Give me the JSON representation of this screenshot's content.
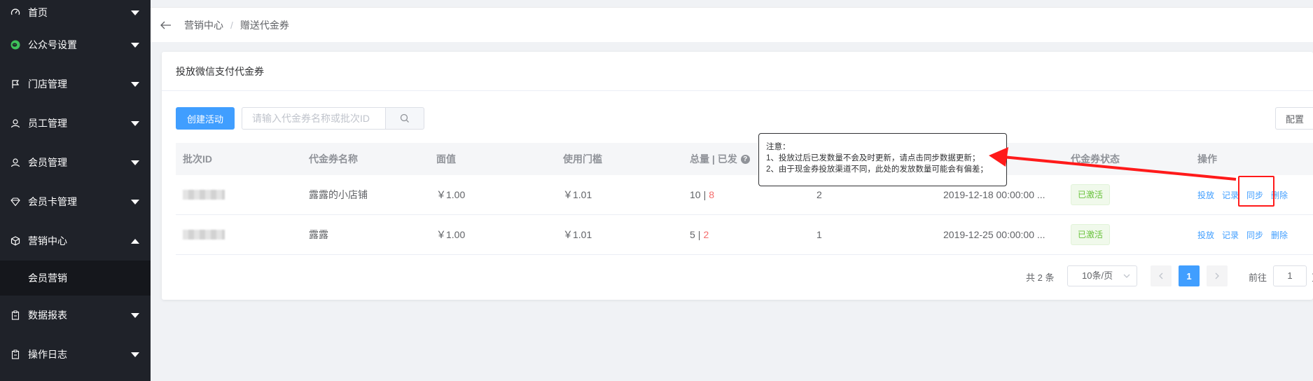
{
  "sidebar": {
    "items": [
      {
        "label": "首页",
        "icon": "dashboard-icon"
      },
      {
        "label": "公众号设置",
        "icon": "wechat-icon"
      },
      {
        "label": "门店管理",
        "icon": "flag-icon"
      },
      {
        "label": "员工管理",
        "icon": "user-icon"
      },
      {
        "label": "会员管理",
        "icon": "user-icon"
      },
      {
        "label": "会员卡管理",
        "icon": "diamond-icon"
      },
      {
        "label": "营销中心",
        "icon": "cube-icon"
      },
      {
        "label": "数据报表",
        "icon": "clipboard-icon"
      },
      {
        "label": "操作日志",
        "icon": "clipboard-icon"
      }
    ],
    "subitem": "会员营销"
  },
  "breadcrumb": {
    "root": "营销中心",
    "separator": "/",
    "current": "赠送代金券"
  },
  "card": {
    "title": "投放微信支付代金券"
  },
  "toolbar": {
    "create_label": "创建活动",
    "search_placeholder": "请输入代金券名称或批次ID",
    "config_label": "配置"
  },
  "table": {
    "headers": [
      "批次ID",
      "代金券名称",
      "面值",
      "使用门槛",
      "总量 | 已发",
      "",
      "",
      "代金券状态",
      "操作"
    ],
    "rows": [
      {
        "name": "露露的小店铺",
        "value": "￥1.00",
        "threshold": "￥1.01",
        "total": "10",
        "sent": "8",
        "col6": "2",
        "time": "2019-12-18 00:00:00 ...",
        "status": "已激活"
      },
      {
        "name": "露露",
        "value": "￥1.00",
        "threshold": "￥1.01",
        "total": "5",
        "sent": "2",
        "col6": "1",
        "time": "2019-12-25 00:00:00 ...",
        "status": "已激活"
      }
    ],
    "actions": [
      "投放",
      "记录",
      "同步",
      "删除"
    ]
  },
  "pagination": {
    "total": "共 2 条",
    "page_size": "10条/页",
    "current_page": "1",
    "goto_label": "前往",
    "goto_value": "1",
    "unit": "页"
  },
  "tooltip": {
    "title": "注意：",
    "line1": "1、投放过后已发数量不会及时更新，请点击同步数据更新；",
    "line2": "2、由于现金券投放渠道不同，此处的发放数量可能会有偏差；"
  },
  "colors": {
    "primary": "#409eff",
    "sidebar_bg": "#1f2229",
    "annotation_red": "#ff1a1a",
    "success": "#67c23a",
    "danger": "#f56c6c"
  }
}
